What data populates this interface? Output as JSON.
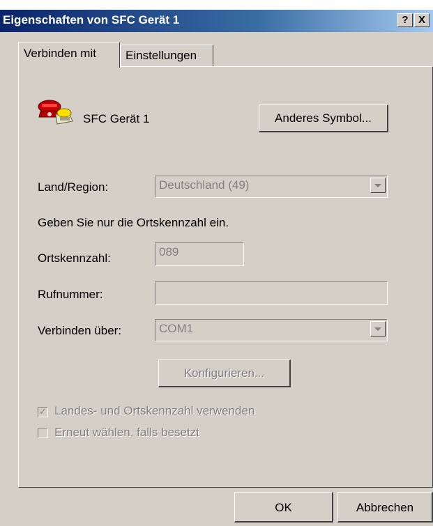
{
  "window": {
    "title": "Eigenschaften von SFC Gerät 1",
    "help_glyph": "?",
    "close_glyph": "X"
  },
  "tabs": [
    {
      "label": "Verbinden mit",
      "active": true
    },
    {
      "label": "Einstellungen",
      "active": false
    }
  ],
  "device": {
    "name": "SFC Gerät 1",
    "icon": "telephone-icon",
    "change_icon_button": "Anderes Symbol..."
  },
  "form": {
    "country_label": "Land/Region:",
    "country_value": "Deutschland (49)",
    "hint": "Geben Sie nur die Ortskennzahl ein.",
    "area_code_label": "Ortskennzahl:",
    "area_code_value": "089",
    "phone_label": "Rufnummer:",
    "phone_value": "",
    "connect_using_label": "Verbinden über:",
    "connect_using_value": "COM1",
    "configure_button": "Konfigurieren...",
    "use_country_code_label": "Landes- und Ortskennzahl verwenden",
    "use_country_code_checked": true,
    "redial_label": "Erneut wählen, falls besetzt",
    "redial_checked": false
  },
  "buttons": {
    "ok": "OK",
    "cancel": "Abbrechen"
  },
  "colors": {
    "titlebar_start": "#0a246a",
    "titlebar_end": "#a6caf0",
    "face": "#d4d0c8",
    "disabled_text": "#808080"
  }
}
